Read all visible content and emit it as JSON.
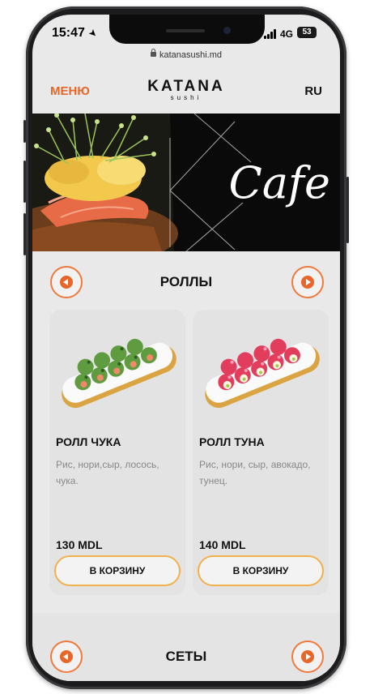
{
  "status_bar": {
    "time": "15:47",
    "network": "4G",
    "battery": "53"
  },
  "browser": {
    "url": "katanasushi.md"
  },
  "header": {
    "menu_label": "МЕНЮ",
    "logo_main": "KATANA",
    "logo_sub": "sushi",
    "language": "RU"
  },
  "hero": {
    "text": "Cafe"
  },
  "categories": [
    {
      "title": "РОЛЛЫ"
    },
    {
      "title": "СЕТЫ"
    }
  ],
  "products": [
    {
      "name": "РОЛЛ ЧУКА",
      "description": "Рис, нори,сыр, лосось, чука.",
      "price": "130 MDL",
      "button_label": "В КОРЗИНУ",
      "topping_color": "#5f9b3f"
    },
    {
      "name": "РОЛЛ ТУНА",
      "description": "Рис, нори, сыр, авокадо, тунец.",
      "price": "140 MDL",
      "button_label": "В КОРЗИНУ",
      "topping_color": "#e23d5c"
    }
  ],
  "colors": {
    "accent": "#e8662a",
    "button_border": "#f0b14d",
    "card_bg": "#e3e3e3",
    "screen_bg": "#e9e9e9"
  }
}
